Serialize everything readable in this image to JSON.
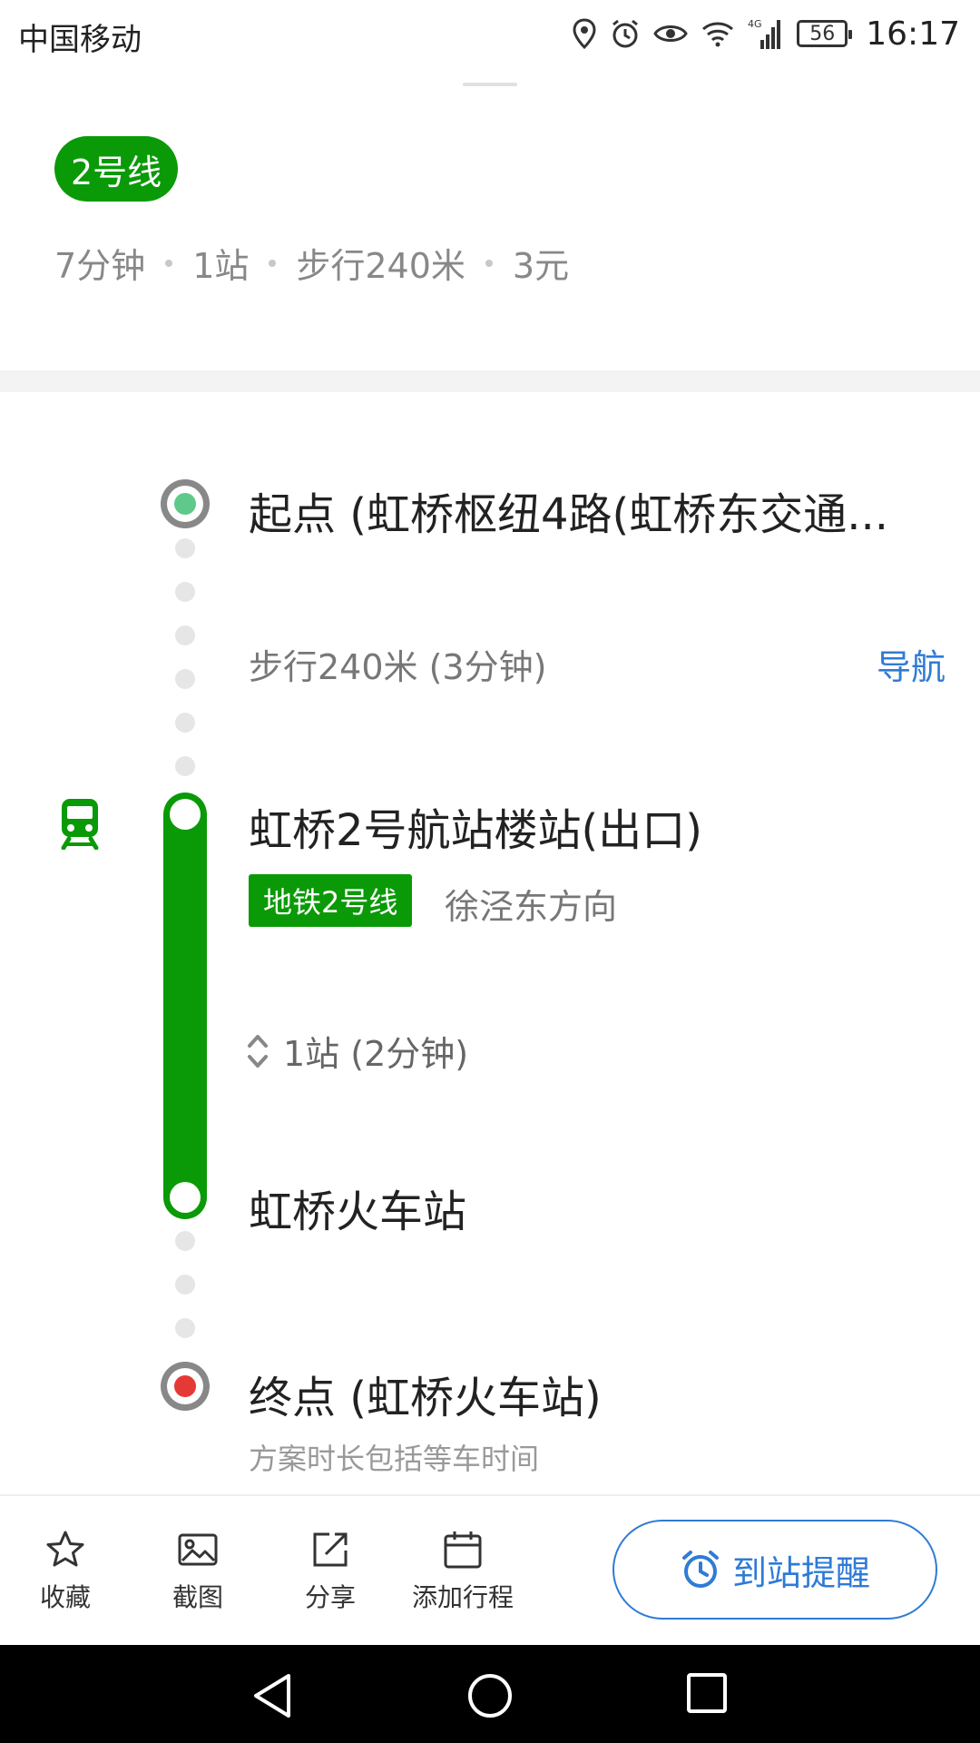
{
  "status": {
    "carrier": "中国移动",
    "network": "4G",
    "battery": "56",
    "time": "16:17"
  },
  "route": {
    "line_chip": "2号线",
    "summary": [
      "7分钟",
      "1站",
      "步行240米",
      "3元"
    ]
  },
  "timeline": {
    "start": "起点 (虹桥枢纽4路(虹桥东交通...",
    "walk": "步行240米 (3分钟)",
    "nav": "导航",
    "board_station": "虹桥2号航站楼站(出口)",
    "line_tag": "地铁2号线",
    "direction": "徐泾东方向",
    "stops": "1站  (2分钟)",
    "alight_station": "虹桥火车站",
    "end": "终点 (虹桥火车站)",
    "note": "方案时长包括等车时间"
  },
  "toolbar": {
    "favorite": "收藏",
    "screenshot": "截图",
    "share": "分享",
    "add_trip": "添加行程",
    "remind": "到站提醒"
  },
  "colors": {
    "green": "#0a9a07",
    "blue": "#2f7bd6",
    "start_dot": "#5ec98a",
    "end_dot": "#e53935"
  }
}
